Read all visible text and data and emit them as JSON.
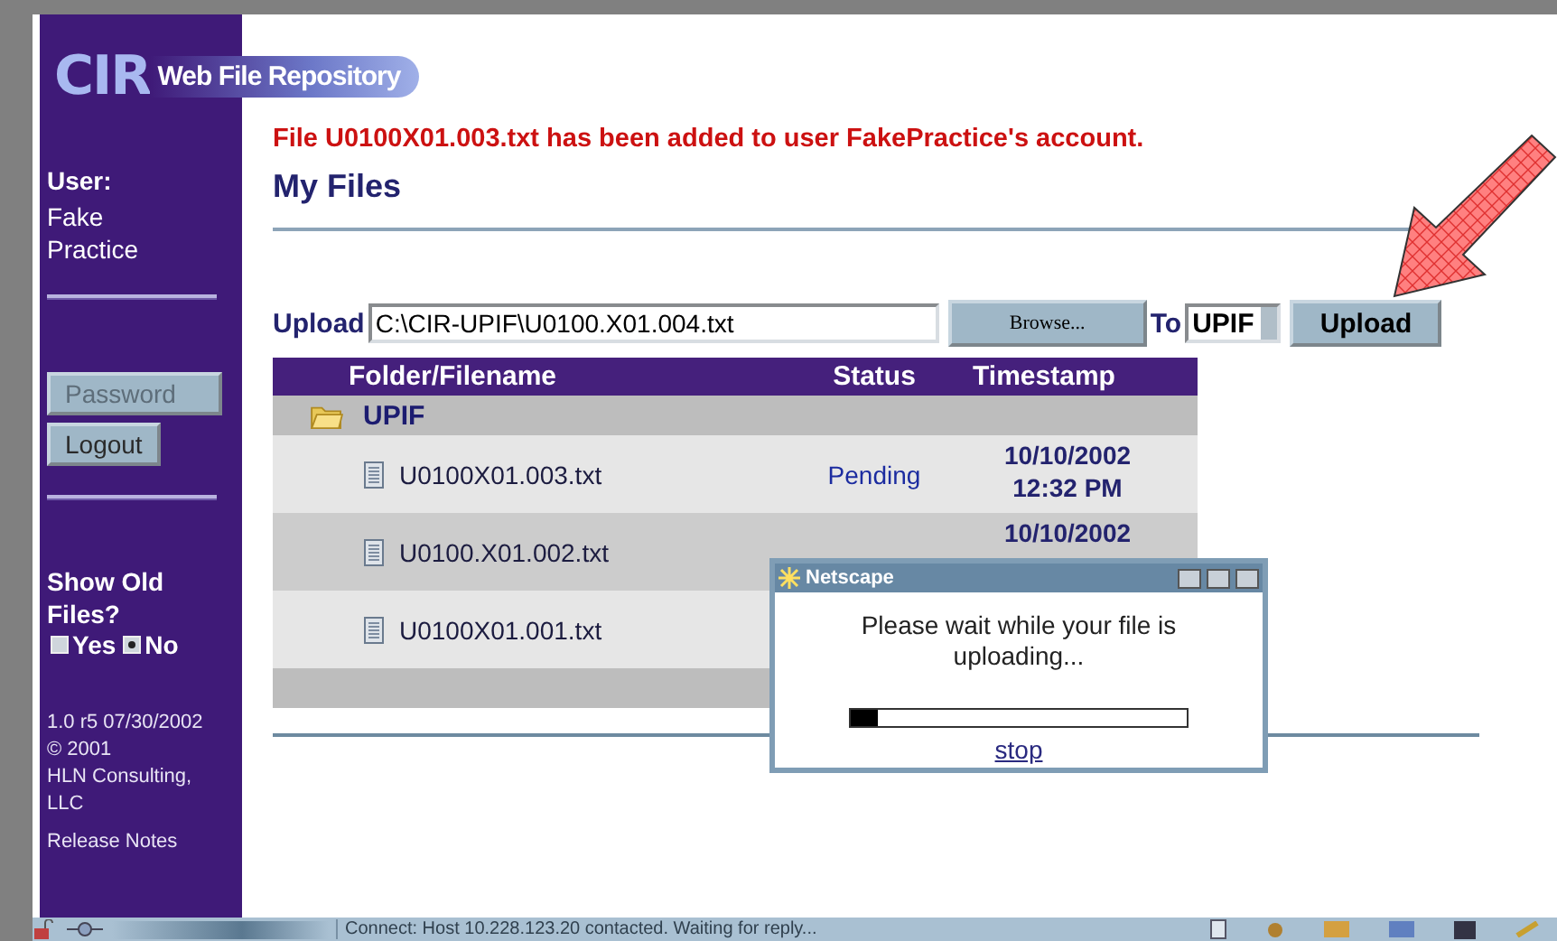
{
  "logo": {
    "mark": "CIR",
    "title": "Web File Repository"
  },
  "sidebar": {
    "user_label": "User:",
    "user_name": "Fake Practice",
    "buttons": [
      {
        "label": "Password",
        "disabled": true
      },
      {
        "label": "Logout",
        "disabled": false
      }
    ],
    "show_old_files": {
      "label": "Show Old Files?",
      "options": [
        {
          "label": "Yes",
          "selected": false
        },
        {
          "label": "No",
          "selected": true
        }
      ]
    },
    "version": "1.0 r5 07/30/2002",
    "copyright": "© 2001",
    "company": "HLN Consulting, LLC",
    "release_notes_link": "Release Notes"
  },
  "message": "File U0100X01.003.txt has been added to user FakePractice's account.",
  "heading": "My Files",
  "upload": {
    "label": "Upload",
    "value": "C:\\CIR-UPIF\\U0100.X01.004.txt",
    "browse_button": "Browse...",
    "to_label": "To",
    "destination": "UPIF",
    "upload_button": "Upload"
  },
  "table": {
    "columns": [
      "Folder/Filename",
      "Status",
      "Timestamp"
    ],
    "folder": "UPIF",
    "rows": [
      {
        "filename": "U0100X01.003.txt",
        "status": "Pending",
        "timestamp": "10/10/2002 12:32 PM"
      },
      {
        "filename": "U0100.X01.002.txt",
        "timestamp": "10/10/2002"
      },
      {
        "filename": "U0100X01.001.txt"
      }
    ]
  },
  "dialog": {
    "title": "Netscape",
    "message": "Please wait while your file is uploading...",
    "progress": {
      "level": 0.08
    },
    "stop_link": "stop"
  },
  "status_bar": {
    "text": "Connect: Host 10.228.123.20 contacted. Waiting for reply..."
  }
}
